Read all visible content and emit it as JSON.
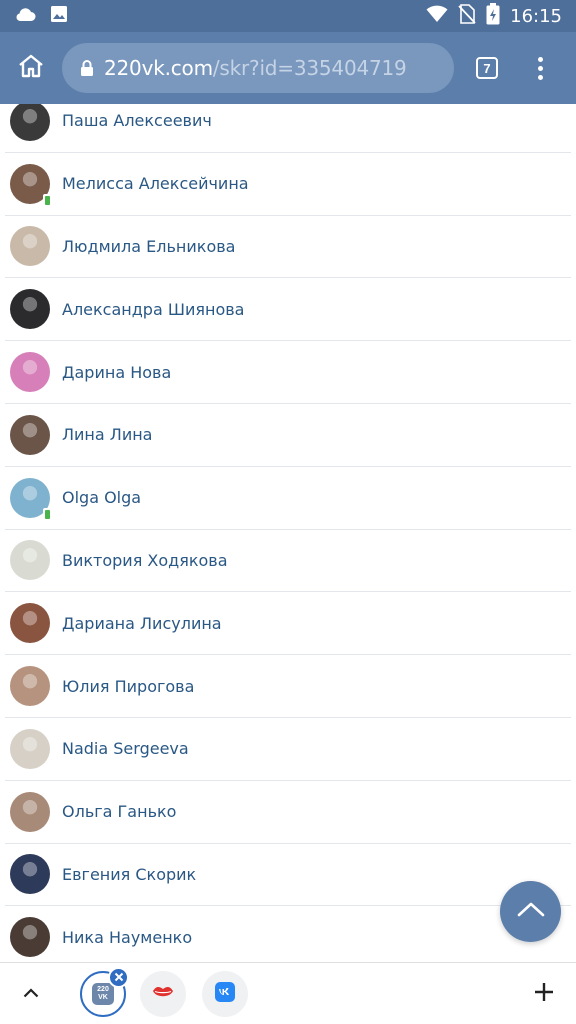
{
  "status_bar": {
    "time": "16:15"
  },
  "browser": {
    "url_host": "220vk.com",
    "url_path": "/skr?id=335404719",
    "tab_count": "7"
  },
  "friends": [
    {
      "name": "Паша Алексеевич",
      "avatar_color": "#3a3a3a",
      "mobile": false
    },
    {
      "name": "Мелисса Алексейчина",
      "avatar_color": "#7a5a48",
      "mobile": true
    },
    {
      "name": "Людмила Ельникова",
      "avatar_color": "#c8b9a8",
      "mobile": false
    },
    {
      "name": "Александра Шиянова",
      "avatar_color": "#2b2b2e",
      "mobile": false
    },
    {
      "name": "Дарина Нова",
      "avatar_color": "#d77fb8",
      "mobile": false
    },
    {
      "name": "Лина Лина",
      "avatar_color": "#6b5548",
      "mobile": false
    },
    {
      "name": "Olga Olga",
      "avatar_color": "#7fb2cf",
      "mobile": true
    },
    {
      "name": "Виктория Ходякова",
      "avatar_color": "#d9dbd2",
      "mobile": false
    },
    {
      "name": "Дариана Лисулина",
      "avatar_color": "#8a5540",
      "mobile": false
    },
    {
      "name": "Юлия Пирогова",
      "avatar_color": "#b5937e",
      "mobile": false
    },
    {
      "name": "Nadia Sergeeva",
      "avatar_color": "#d6d0c6",
      "mobile": false
    },
    {
      "name": "Ольга Ганько",
      "avatar_color": "#a88a78",
      "mobile": false
    },
    {
      "name": "Евгения Скорик",
      "avatar_color": "#2e3a5a",
      "mobile": false
    },
    {
      "name": "Ника Науменко",
      "avatar_color": "#4a3c34",
      "mobile": false
    }
  ],
  "bottom_bar": {
    "active_tab_badge": "220 VK"
  },
  "colors": {
    "status_bar": "#4e6f99",
    "toolbar": "#5b7eab",
    "link_text": "#2a5885",
    "divider": "#e3e6ea"
  }
}
